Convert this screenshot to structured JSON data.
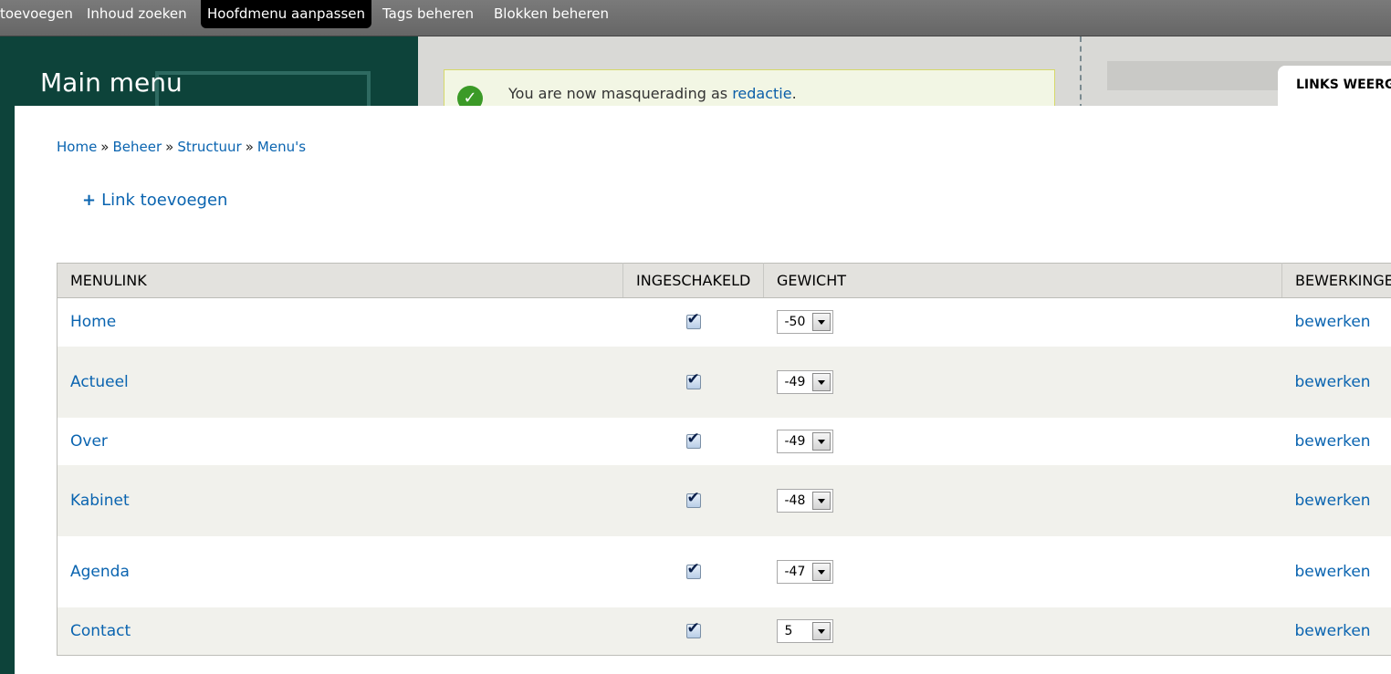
{
  "toolbar": {
    "items": [
      {
        "label": "toevoegen",
        "active": false
      },
      {
        "label": "Inhoud zoeken",
        "active": false
      },
      {
        "label": "Hoofdmenu aanpassen",
        "active": true
      },
      {
        "label": "Tags beheren",
        "active": false
      },
      {
        "label": "Blokken beheren",
        "active": false
      }
    ]
  },
  "background": {
    "message_prefix": "You are now masquerading as",
    "message_user": "redactie",
    "message_suffix": "."
  },
  "overlay": {
    "title": "Main menu",
    "tab_label": "LINKS WEERG"
  },
  "breadcrumb": [
    "Home",
    "Beheer",
    "Structuur",
    "Menu's"
  ],
  "breadcrumb_separator": "»",
  "actions": {
    "add_link_icon": "+",
    "add_link_label": "Link toevoegen"
  },
  "table": {
    "headers": {
      "menulink": "MENULINK",
      "enabled": "INGESCHAKELD",
      "weight": "GEWICHT",
      "operations": "BEWERKINGEN"
    },
    "rows": [
      {
        "title": "Home",
        "enabled": true,
        "weight": "-50",
        "op": "bewerken"
      },
      {
        "title": "Actueel",
        "enabled": true,
        "weight": "-49",
        "op": "bewerken"
      },
      {
        "title": "Over",
        "enabled": true,
        "weight": "-49",
        "op": "bewerken"
      },
      {
        "title": "Kabinet",
        "enabled": true,
        "weight": "-48",
        "op": "bewerken"
      },
      {
        "title": "Agenda",
        "enabled": true,
        "weight": "-47",
        "op": "bewerken"
      },
      {
        "title": "Contact",
        "enabled": true,
        "weight": "5",
        "op": "bewerken"
      }
    ]
  },
  "colors": {
    "link": "#0a64b0",
    "toolbar_active": "#000000",
    "header_bg": "#e3e2de",
    "row_alt_bg": "#f1f1ec"
  }
}
